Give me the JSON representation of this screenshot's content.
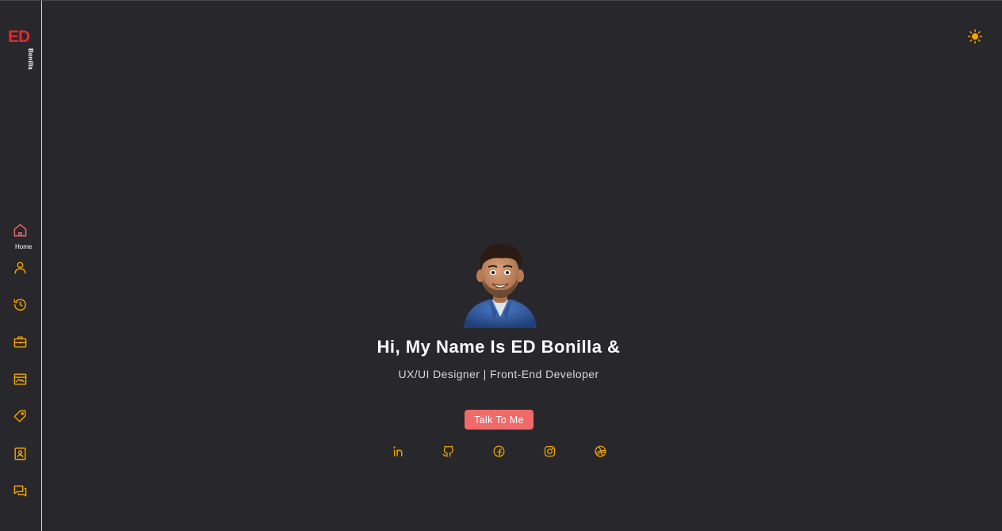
{
  "logo": {
    "mark": "ED",
    "subtitle": "Bonilla"
  },
  "nav": {
    "items": [
      {
        "label": "Home",
        "icon": "home-icon",
        "active": true
      },
      {
        "label": "",
        "icon": "user-icon"
      },
      {
        "label": "",
        "icon": "history-icon"
      },
      {
        "label": "",
        "icon": "briefcase-icon"
      },
      {
        "label": "",
        "icon": "portfolio-icon"
      },
      {
        "label": "",
        "icon": "tag-icon"
      },
      {
        "label": "",
        "icon": "contact-icon"
      },
      {
        "label": "",
        "icon": "chat-icon"
      }
    ]
  },
  "hero": {
    "title": "Hi, My Name Is ED Bonilla &",
    "subtitle": "UX/UI Designer | Front-End Developer",
    "cta_label": "Talk To Me"
  },
  "social": [
    "linkedin-icon",
    "github-icon",
    "facebook-icon",
    "instagram-icon",
    "dribbble-icon"
  ],
  "theme_toggle": {
    "icon": "sun-icon"
  },
  "colors": {
    "background": "#28272c",
    "accent": "#f0a500",
    "active": "#f06a6a",
    "logo": "#e02b2b",
    "cta": "#f06a6a"
  }
}
